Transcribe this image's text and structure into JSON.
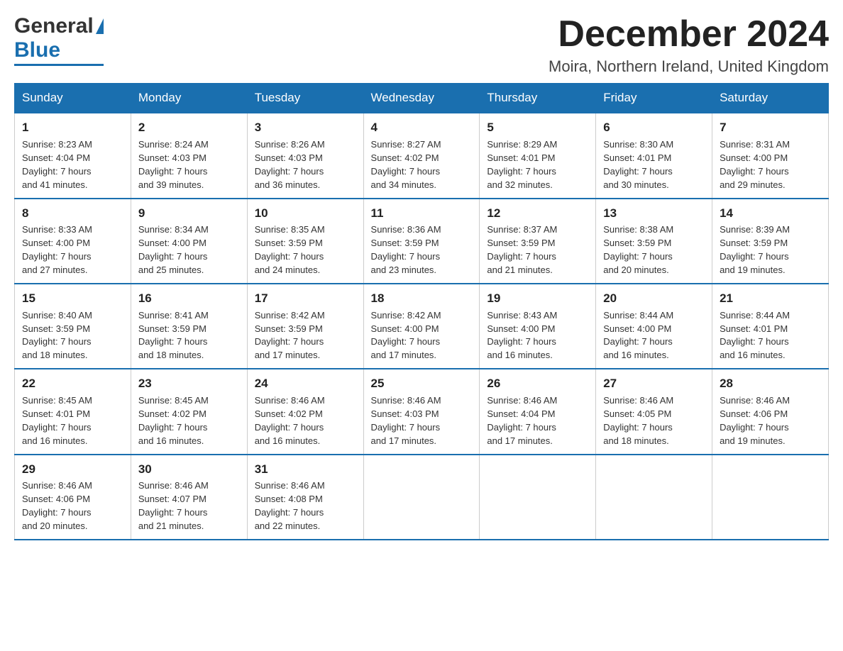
{
  "header": {
    "logo_general": "General",
    "logo_blue": "Blue",
    "month_title": "December 2024",
    "location": "Moira, Northern Ireland, United Kingdom"
  },
  "weekdays": [
    "Sunday",
    "Monday",
    "Tuesday",
    "Wednesday",
    "Thursday",
    "Friday",
    "Saturday"
  ],
  "weeks": [
    [
      {
        "day": "1",
        "sunrise": "8:23 AM",
        "sunset": "4:04 PM",
        "daylight": "7 hours and 41 minutes."
      },
      {
        "day": "2",
        "sunrise": "8:24 AM",
        "sunset": "4:03 PM",
        "daylight": "7 hours and 39 minutes."
      },
      {
        "day": "3",
        "sunrise": "8:26 AM",
        "sunset": "4:03 PM",
        "daylight": "7 hours and 36 minutes."
      },
      {
        "day": "4",
        "sunrise": "8:27 AM",
        "sunset": "4:02 PM",
        "daylight": "7 hours and 34 minutes."
      },
      {
        "day": "5",
        "sunrise": "8:29 AM",
        "sunset": "4:01 PM",
        "daylight": "7 hours and 32 minutes."
      },
      {
        "day": "6",
        "sunrise": "8:30 AM",
        "sunset": "4:01 PM",
        "daylight": "7 hours and 30 minutes."
      },
      {
        "day": "7",
        "sunrise": "8:31 AM",
        "sunset": "4:00 PM",
        "daylight": "7 hours and 29 minutes."
      }
    ],
    [
      {
        "day": "8",
        "sunrise": "8:33 AM",
        "sunset": "4:00 PM",
        "daylight": "7 hours and 27 minutes."
      },
      {
        "day": "9",
        "sunrise": "8:34 AM",
        "sunset": "4:00 PM",
        "daylight": "7 hours and 25 minutes."
      },
      {
        "day": "10",
        "sunrise": "8:35 AM",
        "sunset": "3:59 PM",
        "daylight": "7 hours and 24 minutes."
      },
      {
        "day": "11",
        "sunrise": "8:36 AM",
        "sunset": "3:59 PM",
        "daylight": "7 hours and 23 minutes."
      },
      {
        "day": "12",
        "sunrise": "8:37 AM",
        "sunset": "3:59 PM",
        "daylight": "7 hours and 21 minutes."
      },
      {
        "day": "13",
        "sunrise": "8:38 AM",
        "sunset": "3:59 PM",
        "daylight": "7 hours and 20 minutes."
      },
      {
        "day": "14",
        "sunrise": "8:39 AM",
        "sunset": "3:59 PM",
        "daylight": "7 hours and 19 minutes."
      }
    ],
    [
      {
        "day": "15",
        "sunrise": "8:40 AM",
        "sunset": "3:59 PM",
        "daylight": "7 hours and 18 minutes."
      },
      {
        "day": "16",
        "sunrise": "8:41 AM",
        "sunset": "3:59 PM",
        "daylight": "7 hours and 18 minutes."
      },
      {
        "day": "17",
        "sunrise": "8:42 AM",
        "sunset": "3:59 PM",
        "daylight": "7 hours and 17 minutes."
      },
      {
        "day": "18",
        "sunrise": "8:42 AM",
        "sunset": "4:00 PM",
        "daylight": "7 hours and 17 minutes."
      },
      {
        "day": "19",
        "sunrise": "8:43 AM",
        "sunset": "4:00 PM",
        "daylight": "7 hours and 16 minutes."
      },
      {
        "day": "20",
        "sunrise": "8:44 AM",
        "sunset": "4:00 PM",
        "daylight": "7 hours and 16 minutes."
      },
      {
        "day": "21",
        "sunrise": "8:44 AM",
        "sunset": "4:01 PM",
        "daylight": "7 hours and 16 minutes."
      }
    ],
    [
      {
        "day": "22",
        "sunrise": "8:45 AM",
        "sunset": "4:01 PM",
        "daylight": "7 hours and 16 minutes."
      },
      {
        "day": "23",
        "sunrise": "8:45 AM",
        "sunset": "4:02 PM",
        "daylight": "7 hours and 16 minutes."
      },
      {
        "day": "24",
        "sunrise": "8:46 AM",
        "sunset": "4:02 PM",
        "daylight": "7 hours and 16 minutes."
      },
      {
        "day": "25",
        "sunrise": "8:46 AM",
        "sunset": "4:03 PM",
        "daylight": "7 hours and 17 minutes."
      },
      {
        "day": "26",
        "sunrise": "8:46 AM",
        "sunset": "4:04 PM",
        "daylight": "7 hours and 17 minutes."
      },
      {
        "day": "27",
        "sunrise": "8:46 AM",
        "sunset": "4:05 PM",
        "daylight": "7 hours and 18 minutes."
      },
      {
        "day": "28",
        "sunrise": "8:46 AM",
        "sunset": "4:06 PM",
        "daylight": "7 hours and 19 minutes."
      }
    ],
    [
      {
        "day": "29",
        "sunrise": "8:46 AM",
        "sunset": "4:06 PM",
        "daylight": "7 hours and 20 minutes."
      },
      {
        "day": "30",
        "sunrise": "8:46 AM",
        "sunset": "4:07 PM",
        "daylight": "7 hours and 21 minutes."
      },
      {
        "day": "31",
        "sunrise": "8:46 AM",
        "sunset": "4:08 PM",
        "daylight": "7 hours and 22 minutes."
      },
      null,
      null,
      null,
      null
    ]
  ],
  "labels": {
    "sunrise": "Sunrise:",
    "sunset": "Sunset:",
    "daylight": "Daylight:"
  }
}
